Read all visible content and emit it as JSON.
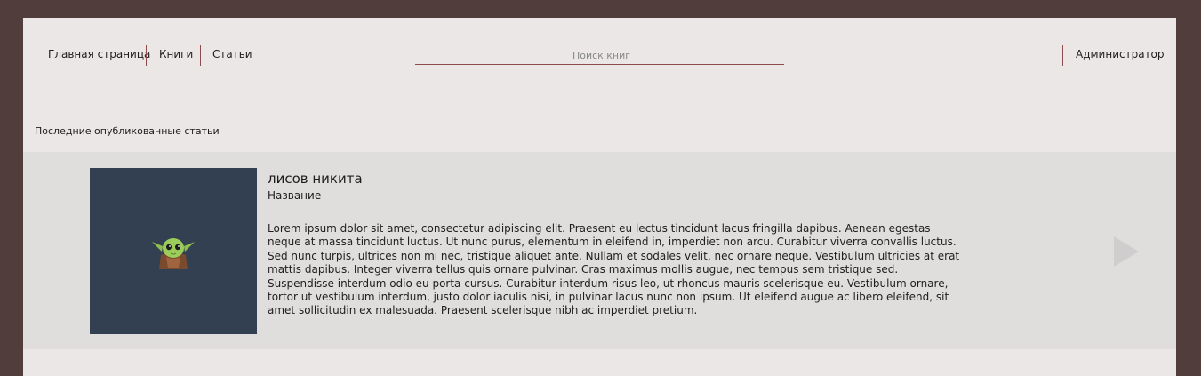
{
  "nav": {
    "home": "Главная страница",
    "books": "Книги",
    "articles": "Статьи",
    "admin": "Администратор"
  },
  "search": {
    "placeholder": "Поиск книг"
  },
  "section": {
    "title": "Последние опубликованные статьи"
  },
  "article": {
    "author": "лисов никита",
    "title": "Название",
    "image_icon": "baby-yoda-avatar",
    "body": "Lorem ipsum dolor sit amet, consectetur adipiscing elit. Praesent eu lectus tincidunt lacus fringilla dapibus. Aenean egestas neque at massa tincidunt luctus. Ut nunc purus, elementum in eleifend in, imperdiet non arcu. Curabitur viverra convallis luctus. Sed nunc turpis, ultrices non mi nec, tristique aliquet ante. Nullam et sodales velit, nec ornare neque. Vestibulum ultricies at erat mattis dapibus. Integer viverra tellus quis ornare pulvinar. Cras maximus mollis augue, nec tempus sem tristique sed. Suspendisse interdum odio eu porta cursus. Curabitur interdum risus leo, ut rhoncus mauris scelerisque eu. Vestibulum ornare, tortor ut vestibulum interdum, justo dolor iaculis nisi, in pulvinar lacus nunc non ipsum. Ut eleifend augue ac libero eleifend, sit amet sollicitudin ex malesuada. Praesent scelerisque nibh ac imperdiet pretium."
  },
  "slider": {
    "next_icon": "play-triangle-icon"
  },
  "colors": {
    "outer_bg": "#523d3d",
    "page_bg": "#ebe7e6",
    "slider_bg": "#dfdedd",
    "thumb_bg": "#334051",
    "accent": "#8e4c4c"
  }
}
